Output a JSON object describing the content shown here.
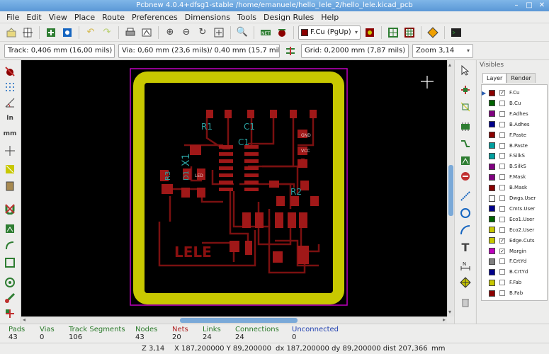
{
  "window": {
    "title": "Pcbnew 4.0.4+dfsg1-stable /home/emanuele/hello_lele_2/hello_lele.kicad_pcb",
    "buttons": [
      "–",
      "□",
      "✕"
    ]
  },
  "menu": [
    "File",
    "Edit",
    "View",
    "Place",
    "Route",
    "Preferences",
    "Dimensions",
    "Tools",
    "Design Rules",
    "Help"
  ],
  "toolbar": {
    "active_layer": "F.Cu (PgUp)",
    "track": "Track: 0,406 mm (16,00 mils) *",
    "via": "Via: 0,60 mm (23,6 mils)/ 0,40 mm (15,7 mils) *",
    "grid": "Grid: 0,2000 mm (7,87 mils)",
    "zoom": "Zoom 3,14"
  },
  "board": {
    "labels": {
      "r1": "R1",
      "c1a": "C1",
      "c1b": "C1",
      "x1": "X1",
      "r2": "R2",
      "lele": "LELE",
      "d1": "D1",
      "rb": "R3"
    },
    "pad_labels": {
      "led": "LED",
      "gnd": "GND",
      "vcc": "VCC"
    }
  },
  "layers_panel": {
    "title": "Visibles",
    "tabs": [
      "Layer",
      "Render"
    ],
    "layers": [
      {
        "name": "F.Cu",
        "color": "#8b0000",
        "checked": true,
        "active": true
      },
      {
        "name": "B.Cu",
        "color": "#006400",
        "checked": false
      },
      {
        "name": "F.Adhes",
        "color": "#800080",
        "checked": false
      },
      {
        "name": "B.Adhes",
        "color": "#00008b",
        "checked": false
      },
      {
        "name": "F.Paste",
        "color": "#8b0000",
        "checked": false
      },
      {
        "name": "B.Paste",
        "color": "#00a0a0",
        "checked": false
      },
      {
        "name": "F.SilkS",
        "color": "#00a0a0",
        "checked": false
      },
      {
        "name": "B.SilkS",
        "color": "#800080",
        "checked": false
      },
      {
        "name": "F.Mask",
        "color": "#800080",
        "checked": false
      },
      {
        "name": "B.Mask",
        "color": "#8b0000",
        "checked": false
      },
      {
        "name": "Dwgs.User",
        "color": "#ffffff",
        "checked": false
      },
      {
        "name": "Cmts.User",
        "color": "#00008b",
        "checked": false
      },
      {
        "name": "Eco1.User",
        "color": "#006400",
        "checked": false
      },
      {
        "name": "Eco2.User",
        "color": "#c8c800",
        "checked": false
      },
      {
        "name": "Edge.Cuts",
        "color": "#c8c800",
        "checked": true
      },
      {
        "name": "Margin",
        "color": "#c000c0",
        "checked": true
      },
      {
        "name": "F.CrtYd",
        "color": "#808080",
        "checked": false
      },
      {
        "name": "B.CrtYd",
        "color": "#00008b",
        "checked": false
      },
      {
        "name": "F.Fab",
        "color": "#c8c800",
        "checked": false
      },
      {
        "name": "B.Fab",
        "color": "#8b0000",
        "checked": false
      }
    ]
  },
  "stats": [
    {
      "label": "Pads",
      "value": "43",
      "color": "#2a7a2a"
    },
    {
      "label": "Vias",
      "value": "0",
      "color": "#2a7a2a"
    },
    {
      "label": "Track Segments",
      "value": "106",
      "color": "#2a7a2a"
    },
    {
      "label": "Nodes",
      "value": "43",
      "color": "#2a7a2a"
    },
    {
      "label": "Nets",
      "value": "20",
      "color": "#b02020"
    },
    {
      "label": "Links",
      "value": "24",
      "color": "#2a7a2a"
    },
    {
      "label": "Connections",
      "value": "24",
      "color": "#2a7a2a"
    },
    {
      "label": "Unconnected",
      "value": "0",
      "color": "#2040b0"
    }
  ],
  "status": {
    "zoom": "Z 3,14",
    "abs": "X 187,200000  Y 89,200000",
    "rel": "dx 187,200000  dy 89,200000  dist 207,366",
    "units": "mm"
  }
}
